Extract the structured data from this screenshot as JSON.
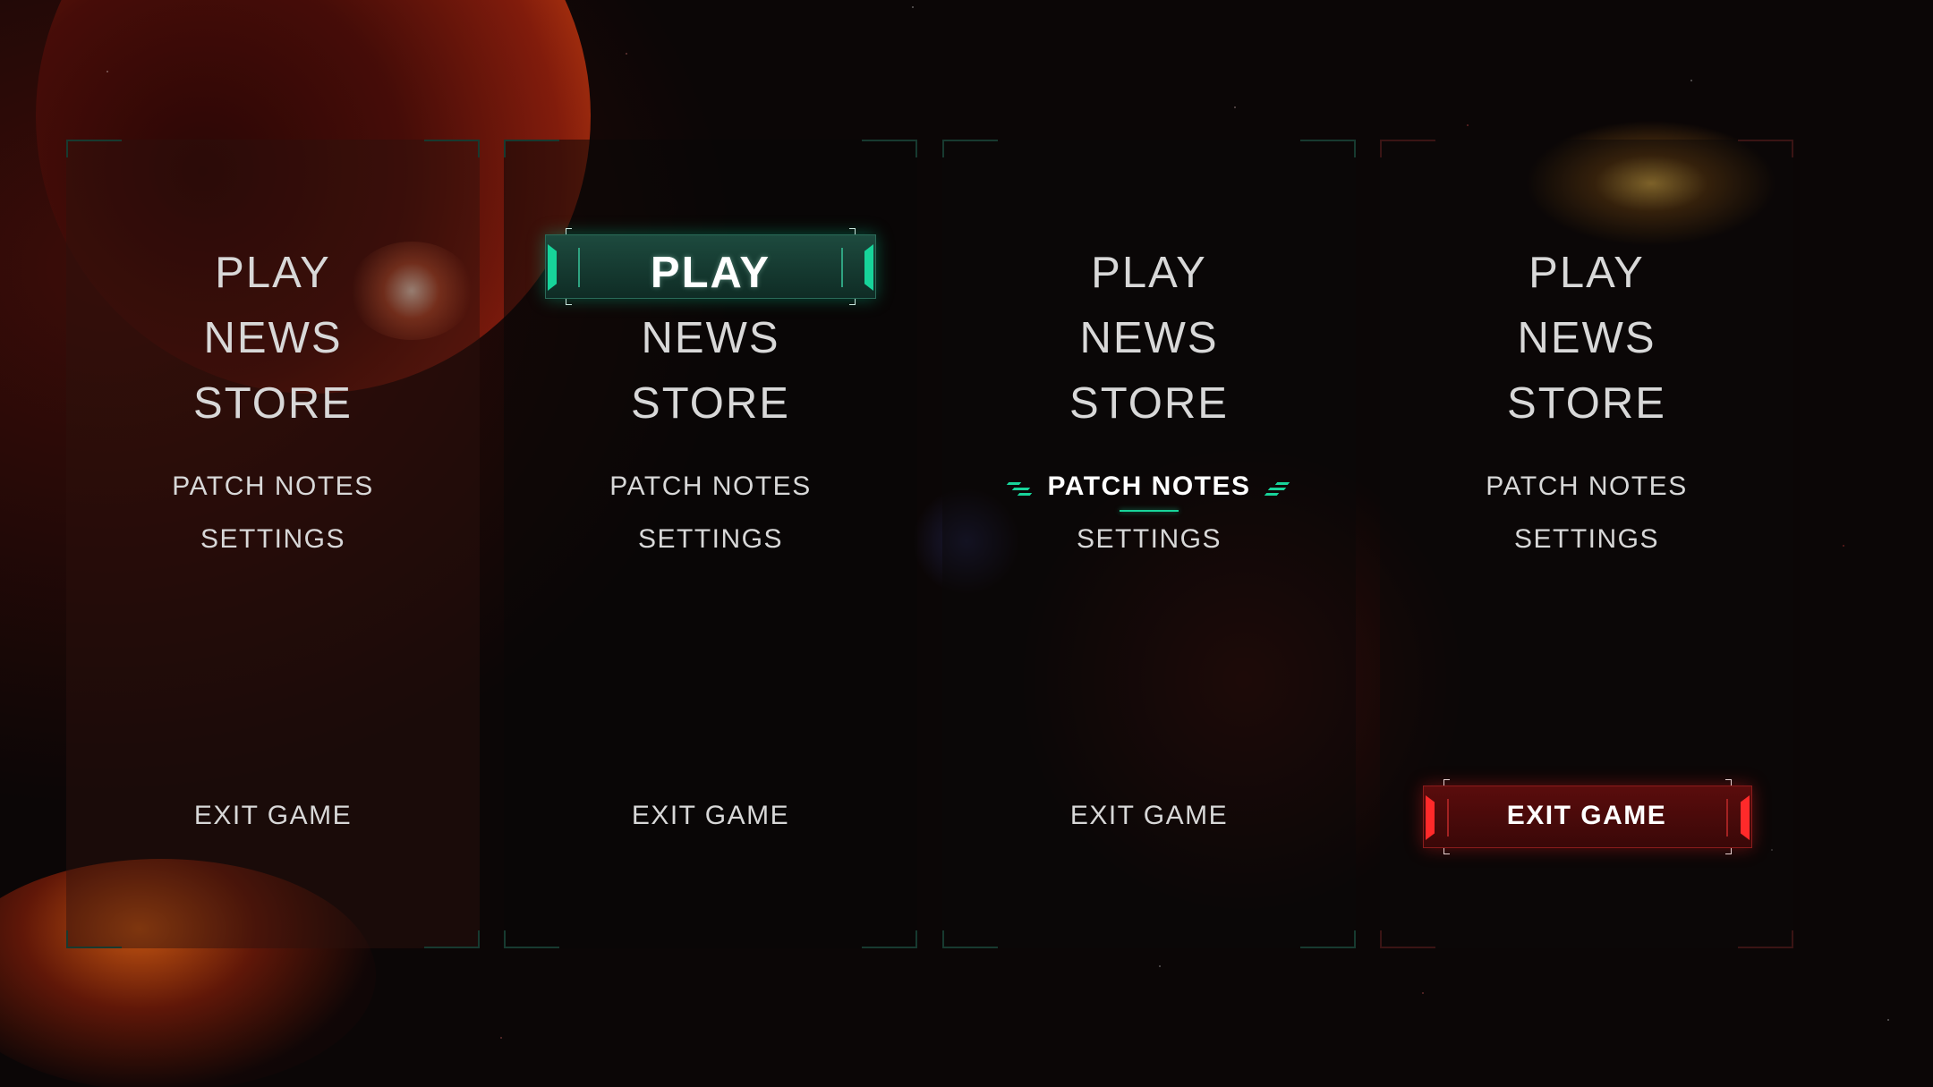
{
  "menu": {
    "play": "PLAY",
    "news": "NEWS",
    "store": "STORE",
    "patch_notes": "PATCH NOTES",
    "settings": "SETTINGS",
    "exit_game": "EXIT GAME"
  },
  "variants": [
    {
      "state": "default",
      "highlighted": "none"
    },
    {
      "state": "hover",
      "highlighted": "PLAY",
      "accent": "#17d49a"
    },
    {
      "state": "hover",
      "highlighted": "PATCH NOTES",
      "accent": "#18d49a"
    },
    {
      "state": "hover",
      "highlighted": "EXIT GAME",
      "accent": "#ff2a2a"
    }
  ],
  "icons": {
    "chevron_left": "chevrons-left-icon",
    "chevron_right": "chevrons-right-icon"
  }
}
